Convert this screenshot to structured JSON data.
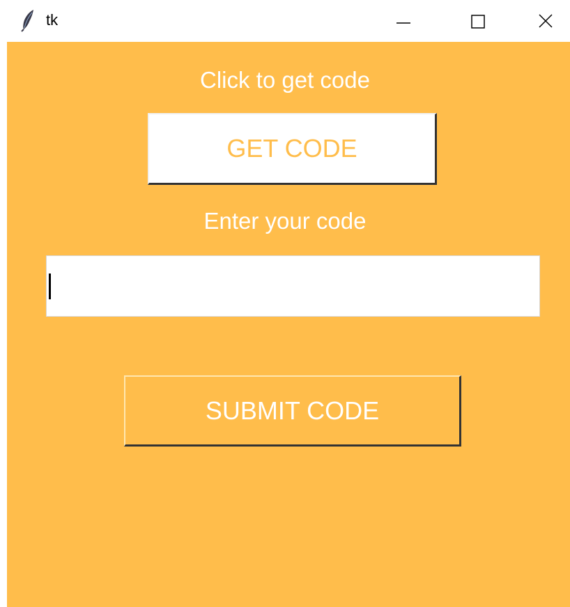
{
  "window": {
    "title": "tk",
    "controls": {
      "minimize_icon": "minimize-icon",
      "maximize_icon": "maximize-icon",
      "close_icon": "close-icon"
    }
  },
  "main": {
    "get_code_prompt": "Click to get code",
    "get_code_button": "GET CODE",
    "enter_code_prompt": "Enter your code",
    "code_input_value": "",
    "submit_button": "SUBMIT CODE"
  },
  "colors": {
    "background": "#ffbd4b",
    "text_light": "#ffffff",
    "button_text_accent": "#ffbd4b"
  }
}
